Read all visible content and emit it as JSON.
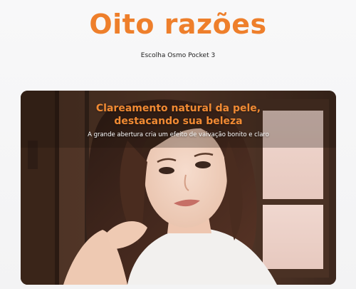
{
  "header": {
    "title": "Oito razões",
    "subtitle": "Escolha Osmo Pocket 3"
  },
  "feature_card": {
    "headline_line1": "Clareamento natural da pele,",
    "headline_line2": "destacando sua beleza",
    "description": "A grande abertura cria um efeito de vaivação bonito e claro",
    "image": "portrait-photo"
  },
  "colors": {
    "accent": "#ee7f2b",
    "page_bg": "#f6f6f7"
  }
}
